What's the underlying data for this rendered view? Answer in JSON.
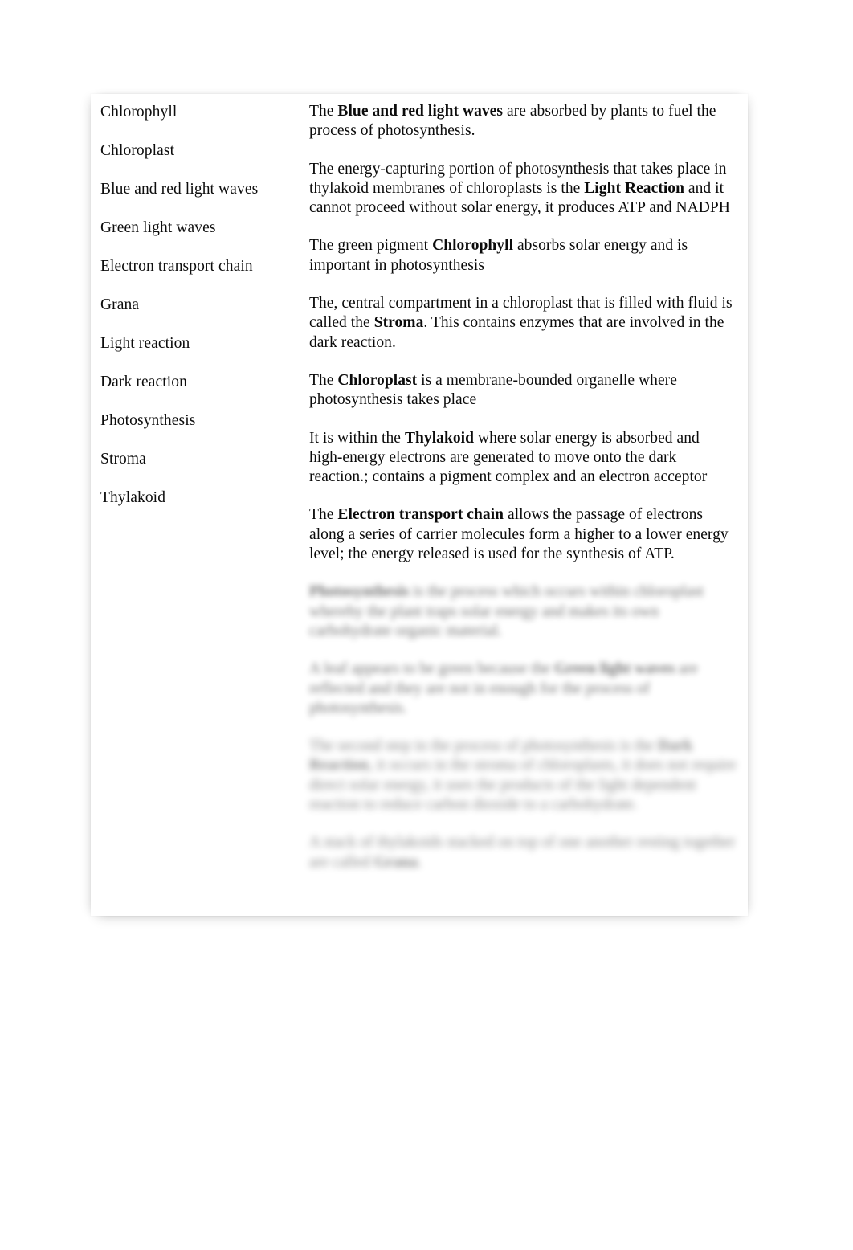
{
  "document": {
    "left_column": {
      "terms": [
        {
          "label": "Chlorophyll"
        },
        {
          "label": "Chloroplast"
        },
        {
          "label": "Blue and red light waves"
        },
        {
          "label": "Green light waves"
        },
        {
          "label": "Electron transport chain"
        },
        {
          "label": "Grana"
        },
        {
          "label": "Light reaction"
        },
        {
          "label": "Dark reaction"
        },
        {
          "label": "Photosynthesis"
        },
        {
          "label": "Stroma"
        },
        {
          "label": "Thylakoid"
        }
      ]
    },
    "right_column": {
      "definitions": [
        {
          "id": "blue-red-light-waves",
          "blurred": false,
          "parts": [
            {
              "text": "The ",
              "bold": false
            },
            {
              "text": "Blue and red light waves",
              "bold": true
            },
            {
              "text": " are absorbed by plants to fuel the process of photosynthesis.",
              "bold": false
            }
          ]
        },
        {
          "id": "light-reaction",
          "blurred": false,
          "parts": [
            {
              "text": "The energy-capturing portion of photosynthesis that takes place in thylakoid membranes of chloroplasts is the ",
              "bold": false
            },
            {
              "text": "Light Reaction",
              "bold": true
            },
            {
              "text": " and it cannot proceed without solar energy, it produces ATP and NADPH",
              "bold": false
            }
          ]
        },
        {
          "id": "chlorophyll",
          "blurred": false,
          "parts": [
            {
              "text": "The green pigment ",
              "bold": false
            },
            {
              "text": "Chlorophyll",
              "bold": true
            },
            {
              "text": " absorbs solar energy and is important in photosynthesis",
              "bold": false
            }
          ]
        },
        {
          "id": "stroma",
          "blurred": false,
          "parts": [
            {
              "text": "The, central compartment in a chloroplast that is filled with fluid is called the ",
              "bold": false
            },
            {
              "text": "Stroma",
              "bold": true
            },
            {
              "text": ". This contains enzymes that are involved in the dark reaction.",
              "bold": false
            }
          ]
        },
        {
          "id": "chloroplast",
          "blurred": false,
          "parts": [
            {
              "text": "The ",
              "bold": false
            },
            {
              "text": "Chloroplast",
              "bold": true
            },
            {
              "text": " is a membrane-bounded organelle where photosynthesis takes place",
              "bold": false
            }
          ]
        },
        {
          "id": "thylakoid",
          "blurred": false,
          "parts": [
            {
              "text": "It is within the ",
              "bold": false
            },
            {
              "text": "Thylakoid",
              "bold": true
            },
            {
              "text": " where solar energy is absorbed and high-energy electrons are generated to move onto the dark reaction.; contains a pigment complex and an electron acceptor",
              "bold": false
            }
          ]
        },
        {
          "id": "electron-transport-chain",
          "blurred": false,
          "parts": [
            {
              "text": "The ",
              "bold": false
            },
            {
              "text": "Electron transport chain",
              "bold": true
            },
            {
              "text": " allows the passage of electrons along a series of carrier molecules form a higher to a lower energy level; the energy released is used for the synthesis of ATP.",
              "bold": false
            }
          ]
        },
        {
          "id": "photosynthesis",
          "blurred": true,
          "parts": [
            {
              "text": "Photosynthesis",
              "bold": true
            },
            {
              "text": " is the process which occurs within chloroplast whereby the plant traps solar energy and makes its own carbohydrate organic material.",
              "bold": false
            }
          ]
        },
        {
          "id": "green-light-waves",
          "blurred": true,
          "parts": [
            {
              "text": "A leaf appears to be green because the ",
              "bold": false
            },
            {
              "text": "Green light waves",
              "bold": true
            },
            {
              "text": " are reflected and they are not in enough for the process of photosynthesis.",
              "bold": false
            }
          ]
        },
        {
          "id": "dark-reaction",
          "blurred": true,
          "parts": [
            {
              "text": "The second step in the process of photosynthesis is the ",
              "bold": false
            },
            {
              "text": "Dark Reaction",
              "bold": true
            },
            {
              "text": ", it occurs in the stroma of chloroplasts, it does not require direct solar energy, it uses the products of the light dependent reaction to reduce carbon dioxide to a carbohydrate.",
              "bold": false
            }
          ]
        },
        {
          "id": "grana",
          "blurred": true,
          "parts": [
            {
              "text": "A stack of thylakoids stacked on top of one another resting together are called ",
              "bold": false
            },
            {
              "text": "Grana",
              "bold": true
            },
            {
              "text": ".",
              "bold": false
            }
          ]
        }
      ]
    }
  }
}
